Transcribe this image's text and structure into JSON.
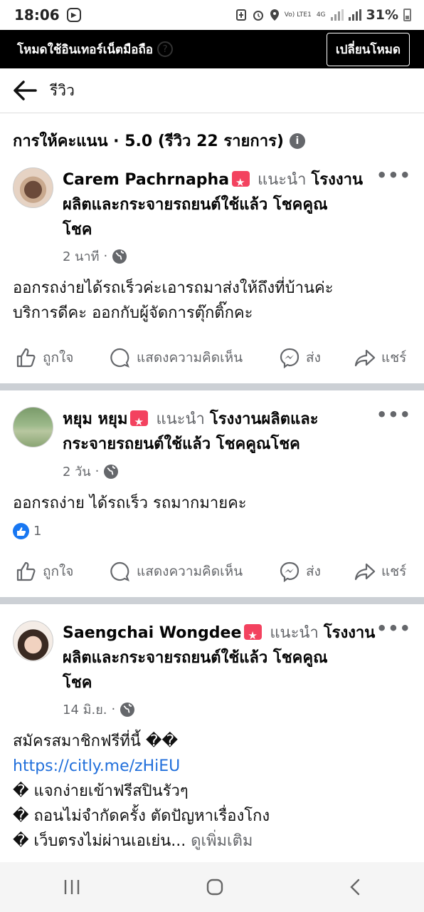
{
  "status_bar": {
    "time": "18:06",
    "network": "4G",
    "volte": "Vo) LTE1",
    "battery": "31%"
  },
  "banner": {
    "message": "โหมดใช้อินเทอร์เน็ตมือถือ",
    "button_label": "เปลี่ยนโหมด"
  },
  "header": {
    "title": "รีวิว"
  },
  "rating_summary": "การให้คะแนน · 5.0 (รีวิว 22 รายการ)",
  "reviews": [
    {
      "name": "Carem Pachrnapha",
      "recommends": "แนะนำ",
      "page": "โรงงานผลิตและกระจายรถยนต์ใช้แล้ว โชคคูณโชค",
      "page_line1": "โรงงาน",
      "page_line2": "ผลิตและกระจายรถยนต์ใช้แล้ว โชคคูณ",
      "page_line3": "โชค",
      "time": "2 นาที",
      "text_line1": "ออกรถง่ายได้รถเร็วค่ะเอารถมาส่งให้ถึงที่บ้านค่ะ",
      "text_line2": "บริการดีคะ ออกกับผู้จัดการตุ๊กติ๊กคะ"
    },
    {
      "name": "หยุม หยุม",
      "recommends": "แนะนำ",
      "page_line1": "โรงงานผลิตและ",
      "page_line2": "กระจายรถยนต์ใช้แล้ว โชคคูณโชค",
      "time": "2 วัน",
      "text_line1": "ออกรถง่าย ได้รถเร็ว รถมากมายคะ",
      "likes": "1"
    },
    {
      "name": "Saengchai Wongdee",
      "recommends": "แนะนำ",
      "page_line1": "โรงงาน",
      "page_line2": "ผลิตและกระจายรถยนต์ใช้แล้ว โชคคูณ",
      "page_line3": "โชค",
      "time": "14 มิ.ย.",
      "text_line1": "สมัครสมาชิกฟรีที่นี้ ��",
      "link": "https://citly.me/zHiEU",
      "text_line3": "� แจกง่ายเข้าฟรีสปินรัวๆ",
      "text_line4": "� ถอนไม่จำกัดครั้ง ตัดปัญหาเรื่องโกง",
      "text_line5": "� เว็บตรงไม่ผ่านเอเย่น...",
      "see_more": "ดูเพิ่มเติม"
    }
  ],
  "actions": {
    "like": "ถูกใจ",
    "comment": "แสดงความคิดเห็น",
    "send": "ส่ง",
    "share": "แชร์"
  },
  "colors": {
    "brand_blue": "#1877f2",
    "link": "#216fdb",
    "recommend_red": "#f3425f",
    "divider": "#ccd0d5"
  }
}
